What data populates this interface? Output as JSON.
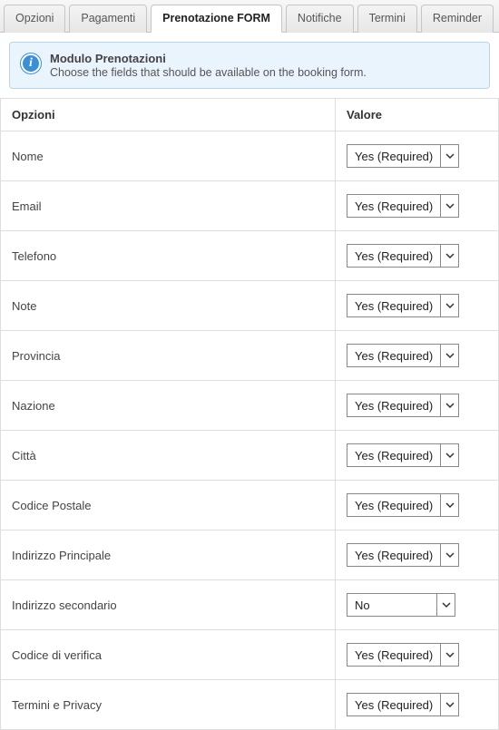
{
  "tabs": [
    {
      "label": "Opzioni",
      "active": false
    },
    {
      "label": "Pagamenti",
      "active": false
    },
    {
      "label": "Prenotazione FORM",
      "active": true
    },
    {
      "label": "Notifiche",
      "active": false
    },
    {
      "label": "Termini",
      "active": false
    },
    {
      "label": "Reminder",
      "active": false
    }
  ],
  "info": {
    "title": "Modulo Prenotazioni",
    "desc": "Choose the fields that should be available on the booking form.",
    "icon_glyph": "i"
  },
  "table": {
    "header_option": "Opzioni",
    "header_value": "Valore",
    "rows": [
      {
        "label": "Nome",
        "value": "Yes (Required)"
      },
      {
        "label": "Email",
        "value": "Yes (Required)"
      },
      {
        "label": "Telefono",
        "value": "Yes (Required)"
      },
      {
        "label": "Note",
        "value": "Yes (Required)"
      },
      {
        "label": "Provincia",
        "value": "Yes (Required)"
      },
      {
        "label": "Nazione",
        "value": "Yes (Required)"
      },
      {
        "label": "Città",
        "value": "Yes (Required)"
      },
      {
        "label": "Codice Postale",
        "value": "Yes (Required)"
      },
      {
        "label": "Indirizzo Principale",
        "value": "Yes (Required)"
      },
      {
        "label": "Indirizzo secondario",
        "value": "No"
      },
      {
        "label": "Codice di verifica",
        "value": "Yes (Required)"
      },
      {
        "label": "Termini e Privacy",
        "value": "Yes (Required)"
      }
    ]
  }
}
